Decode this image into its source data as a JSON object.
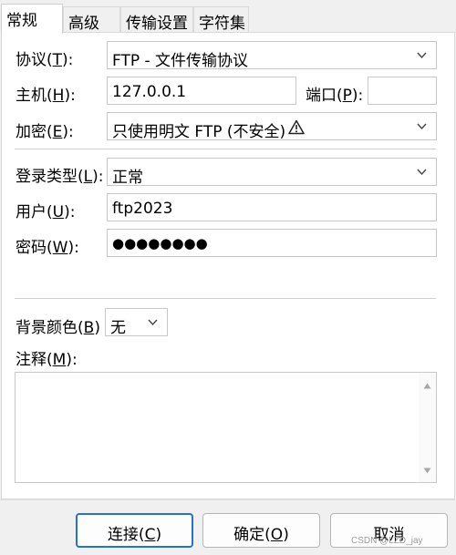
{
  "tabs": [
    {
      "label": "常规"
    },
    {
      "label": "高级"
    },
    {
      "label": "传输设置"
    },
    {
      "label": "字符集"
    }
  ],
  "form": {
    "protocol": {
      "label_pre": "协议(",
      "accel": "T",
      "label_post": "):",
      "value": "FTP - 文件传输协议"
    },
    "host": {
      "label_pre": "主机(",
      "accel": "H",
      "label_post": "):",
      "value": "127.0.0.1"
    },
    "port": {
      "label_pre": "端口(",
      "accel": "P",
      "label_post": "):",
      "value": ""
    },
    "encryption": {
      "label_pre": "加密(",
      "accel": "E",
      "label_post": "):",
      "value": "只使用明文 FTP (不安全)",
      "warning_icon": "warning-triangle-icon"
    },
    "logon_type": {
      "label_pre": "登录类型(",
      "accel": "L",
      "label_post": "):",
      "value": "正常"
    },
    "user": {
      "label_pre": "用户(",
      "accel": "U",
      "label_post": "):",
      "value": "ftp2023"
    },
    "password": {
      "label_pre": "密码(",
      "accel": "W",
      "label_post": "):",
      "value": "●●●●●●●●"
    },
    "background_color": {
      "label_pre": "背景颜色(",
      "accel": "B",
      "label_post": ")",
      "value": "无"
    },
    "comments": {
      "label_pre": "注释(",
      "accel": "M",
      "label_post": "):",
      "value": ""
    }
  },
  "buttons": {
    "connect": {
      "pre": "连接(",
      "accel": "C",
      "post": ")"
    },
    "ok": {
      "pre": "确定(",
      "accel": "O",
      "post": ")"
    },
    "cancel": {
      "label": "取消"
    }
  },
  "watermark": "CSDN @LZD_jay"
}
